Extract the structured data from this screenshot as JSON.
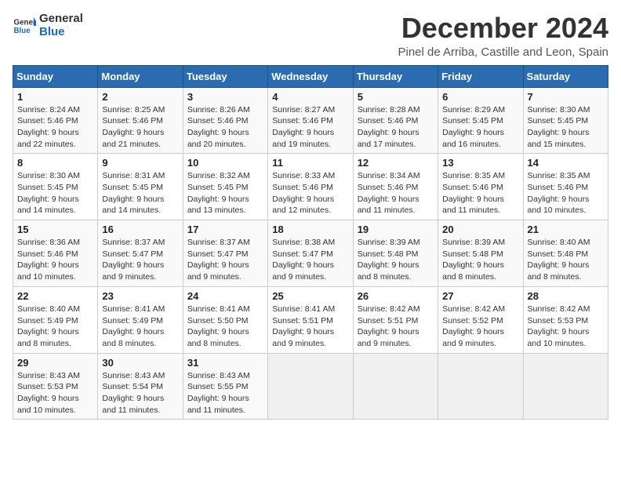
{
  "logo": {
    "general": "General",
    "blue": "Blue"
  },
  "title": "December 2024",
  "subtitle": "Pinel de Arriba, Castille and Leon, Spain",
  "header": {
    "days": [
      "Sunday",
      "Monday",
      "Tuesday",
      "Wednesday",
      "Thursday",
      "Friday",
      "Saturday"
    ]
  },
  "weeks": [
    [
      {
        "day": "1",
        "sunrise": "8:24 AM",
        "sunset": "5:46 PM",
        "daylight": "9 hours and 22 minutes."
      },
      {
        "day": "2",
        "sunrise": "8:25 AM",
        "sunset": "5:46 PM",
        "daylight": "9 hours and 21 minutes."
      },
      {
        "day": "3",
        "sunrise": "8:26 AM",
        "sunset": "5:46 PM",
        "daylight": "9 hours and 20 minutes."
      },
      {
        "day": "4",
        "sunrise": "8:27 AM",
        "sunset": "5:46 PM",
        "daylight": "9 hours and 19 minutes."
      },
      {
        "day": "5",
        "sunrise": "8:28 AM",
        "sunset": "5:46 PM",
        "daylight": "9 hours and 17 minutes."
      },
      {
        "day": "6",
        "sunrise": "8:29 AM",
        "sunset": "5:45 PM",
        "daylight": "9 hours and 16 minutes."
      },
      {
        "day": "7",
        "sunrise": "8:30 AM",
        "sunset": "5:45 PM",
        "daylight": "9 hours and 15 minutes."
      }
    ],
    [
      {
        "day": "8",
        "sunrise": "8:30 AM",
        "sunset": "5:45 PM",
        "daylight": "9 hours and 14 minutes."
      },
      {
        "day": "9",
        "sunrise": "8:31 AM",
        "sunset": "5:45 PM",
        "daylight": "9 hours and 14 minutes."
      },
      {
        "day": "10",
        "sunrise": "8:32 AM",
        "sunset": "5:45 PM",
        "daylight": "9 hours and 13 minutes."
      },
      {
        "day": "11",
        "sunrise": "8:33 AM",
        "sunset": "5:46 PM",
        "daylight": "9 hours and 12 minutes."
      },
      {
        "day": "12",
        "sunrise": "8:34 AM",
        "sunset": "5:46 PM",
        "daylight": "9 hours and 11 minutes."
      },
      {
        "day": "13",
        "sunrise": "8:35 AM",
        "sunset": "5:46 PM",
        "daylight": "9 hours and 11 minutes."
      },
      {
        "day": "14",
        "sunrise": "8:35 AM",
        "sunset": "5:46 PM",
        "daylight": "9 hours and 10 minutes."
      }
    ],
    [
      {
        "day": "15",
        "sunrise": "8:36 AM",
        "sunset": "5:46 PM",
        "daylight": "9 hours and 10 minutes."
      },
      {
        "day": "16",
        "sunrise": "8:37 AM",
        "sunset": "5:47 PM",
        "daylight": "9 hours and 9 minutes."
      },
      {
        "day": "17",
        "sunrise": "8:37 AM",
        "sunset": "5:47 PM",
        "daylight": "9 hours and 9 minutes."
      },
      {
        "day": "18",
        "sunrise": "8:38 AM",
        "sunset": "5:47 PM",
        "daylight": "9 hours and 9 minutes."
      },
      {
        "day": "19",
        "sunrise": "8:39 AM",
        "sunset": "5:48 PM",
        "daylight": "9 hours and 8 minutes."
      },
      {
        "day": "20",
        "sunrise": "8:39 AM",
        "sunset": "5:48 PM",
        "daylight": "9 hours and 8 minutes."
      },
      {
        "day": "21",
        "sunrise": "8:40 AM",
        "sunset": "5:48 PM",
        "daylight": "9 hours and 8 minutes."
      }
    ],
    [
      {
        "day": "22",
        "sunrise": "8:40 AM",
        "sunset": "5:49 PM",
        "daylight": "9 hours and 8 minutes."
      },
      {
        "day": "23",
        "sunrise": "8:41 AM",
        "sunset": "5:49 PM",
        "daylight": "9 hours and 8 minutes."
      },
      {
        "day": "24",
        "sunrise": "8:41 AM",
        "sunset": "5:50 PM",
        "daylight": "9 hours and 8 minutes."
      },
      {
        "day": "25",
        "sunrise": "8:41 AM",
        "sunset": "5:51 PM",
        "daylight": "9 hours and 9 minutes."
      },
      {
        "day": "26",
        "sunrise": "8:42 AM",
        "sunset": "5:51 PM",
        "daylight": "9 hours and 9 minutes."
      },
      {
        "day": "27",
        "sunrise": "8:42 AM",
        "sunset": "5:52 PM",
        "daylight": "9 hours and 9 minutes."
      },
      {
        "day": "28",
        "sunrise": "8:42 AM",
        "sunset": "5:53 PM",
        "daylight": "9 hours and 10 minutes."
      }
    ],
    [
      {
        "day": "29",
        "sunrise": "8:43 AM",
        "sunset": "5:53 PM",
        "daylight": "9 hours and 10 minutes."
      },
      {
        "day": "30",
        "sunrise": "8:43 AM",
        "sunset": "5:54 PM",
        "daylight": "9 hours and 11 minutes."
      },
      {
        "day": "31",
        "sunrise": "8:43 AM",
        "sunset": "5:55 PM",
        "daylight": "9 hours and 11 minutes."
      },
      null,
      null,
      null,
      null
    ]
  ]
}
